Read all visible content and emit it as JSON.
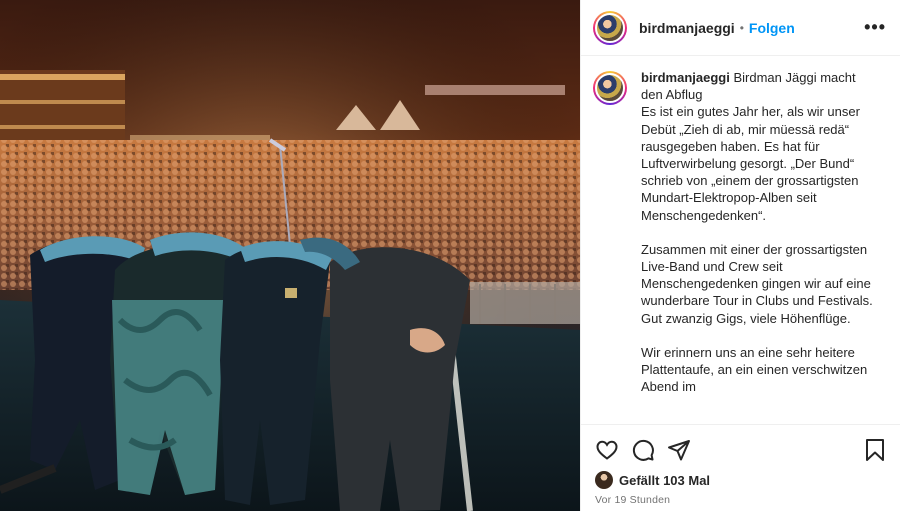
{
  "post": {
    "username": "birdmanjaeggi",
    "separator": "•",
    "follow_label": "Folgen",
    "more_label": "•••",
    "caption_username": "birdmanjaeggi",
    "caption_lines": [
      "Birdman Jäggi macht den Abflug",
      "Es ist ein gutes Jahr her, als wir unser Debüt „Zieh di ab, mir müessä redä“ rausgegeben haben. Es hat für Luftverwirbelung gesorgt. „Der Bund“ schrieb von „einem der grossartigsten Mundart-Elektropop-Alben seit Menschengedenken“.",
      "Zusammen mit einer der grossartigsten Live-Band und Crew seit Menschengedenken gingen wir auf eine wunderbare Tour in Clubs und Festivals. Gut zwanzig Gigs, viele Höhenflüge.",
      "Wir erinnern uns an eine sehr heitere Plattentaufe, an ein einen verschwitzen Abend im"
    ],
    "likes_label": "Gefällt 103 Mal",
    "timestamp": "Vor 19 Stunden"
  },
  "icons": {
    "like": "heart-icon",
    "comment": "comment-icon",
    "share": "share-icon",
    "save": "bookmark-icon",
    "more": "more-icon"
  },
  "colors": {
    "follow": "#0095f6",
    "text": "#262626",
    "muted": "#737373",
    "divider": "#efefef"
  }
}
